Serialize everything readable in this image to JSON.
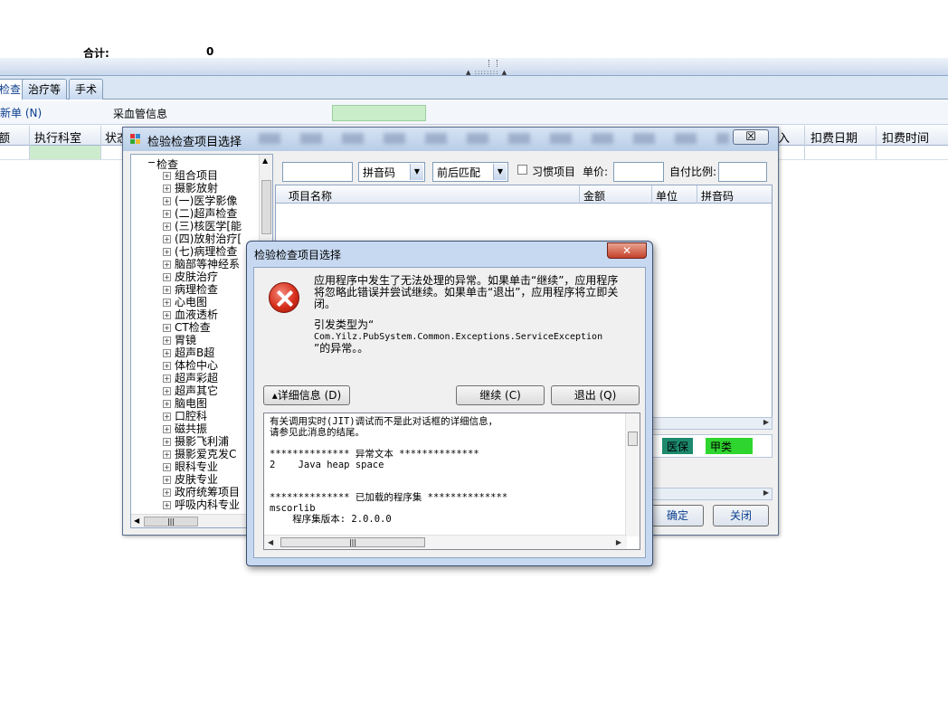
{
  "background": {
    "total_label": "合计:",
    "total_value": "0",
    "tabs": [
      "检查",
      "治疗等",
      "手术"
    ],
    "toolbar": {
      "new_button": "新单 (N)",
      "blood_label": "采血管信息"
    },
    "grid_headers": [
      "额",
      "执行科室",
      "状态",
      "入",
      "扣费日期",
      "扣费时间"
    ]
  },
  "item_window": {
    "title": "检验检查项目选择",
    "close_label": "☒",
    "tree": {
      "root": "检查",
      "items": [
        "组合项目",
        "摄影放射",
        "(一)医学影像",
        "(二)超声检查",
        "(三)核医学[能",
        "(四)放射治疗[",
        "(七)病理检查",
        "脑部等神经系",
        "皮肤治疗",
        "病理检查",
        "心电图",
        "血液透析",
        "CT检查",
        "胃镜",
        "超声B超",
        "体检中心",
        "超声彩超",
        "超声其它",
        "脑电图",
        "口腔科",
        "磁共振",
        "摄影飞利浦",
        "摄影爱克发C",
        "眼科专业",
        "皮肤专业",
        "政府统筹项目",
        "呼吸内科专业"
      ]
    },
    "filters": {
      "search_value": "",
      "pinyin_select": "拼音码",
      "match_select": "前后匹配",
      "habit_label": "习惯项目",
      "price_label": "单价:",
      "price_value": "",
      "selfpay_label": "自付比例:",
      "selfpay_value": ""
    },
    "columns": [
      "项目名称",
      "金额",
      "单位",
      "拼音码"
    ],
    "chips": [
      "医保",
      "甲类"
    ],
    "chip_colors": [
      "#1d8a6e",
      "#2fd52f"
    ],
    "ok_button": "确定",
    "close_button": "关闭"
  },
  "error_dialog": {
    "title": "检验检查项目选择",
    "close_label": "✕",
    "message": "应用程序中发生了无法处理的异常。如果单击“继续”，应用程序将忽略此错误并尝试继续。如果单击“退出”，应用程序将立即关闭。",
    "exception_intro": "引发类型为“",
    "exception_type": "Com.Yilz.PubSystem.Common.Exceptions.ServiceException",
    "exception_outro": "”的异常。。",
    "details_button": "▴详细信息 (D)",
    "continue_button": "继续 (C)",
    "quit_button": "退出 (Q)",
    "details_text": "有关调用实时(JIT)调试而不是此对话框的详细信息，\n请参见此消息的结尾。\n\n************** 异常文本 **************\n2    Java heap space\n\n\n************** 已加载的程序集 **************\nmscorlib\n    程序集版本: 2.0.0.0"
  }
}
